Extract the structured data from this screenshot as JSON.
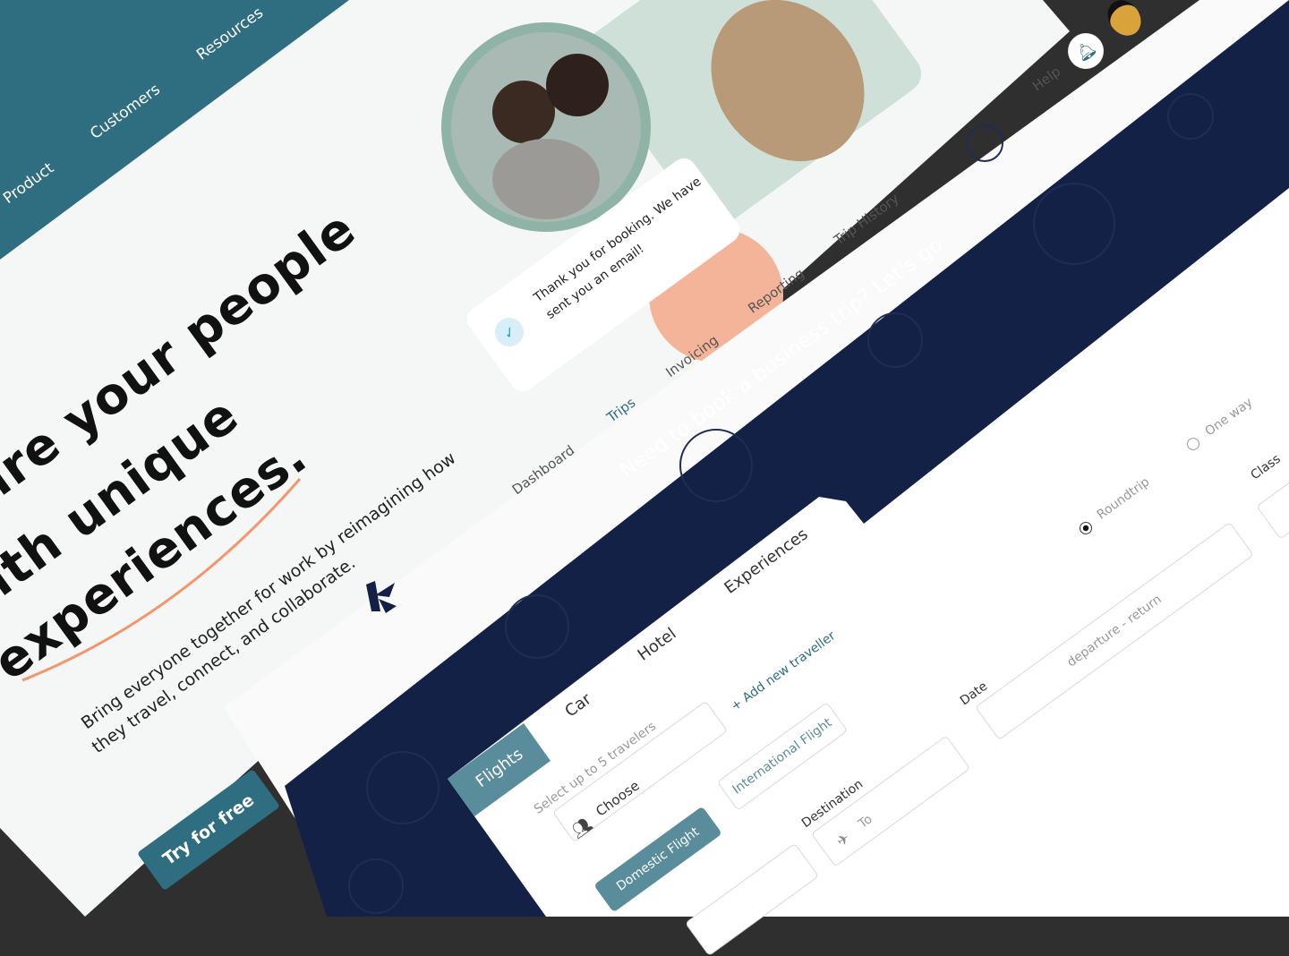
{
  "landing": {
    "nav": [
      "Product",
      "Customers",
      "Resources"
    ],
    "headline": [
      "ire your people",
      "ith unique",
      "experiences."
    ],
    "paragraph": [
      "Bring everyone together for work by reimagining how",
      "they travel, connect, and collaborate."
    ],
    "cta": "Try for free",
    "toast": [
      "Thank you for booking. We have",
      "sent you an email!"
    ]
  },
  "app": {
    "nav": [
      "Dashboard",
      "Trips",
      "Invoicing",
      "Reporting",
      "Trip History"
    ],
    "active_nav": "Trips",
    "help": "Help",
    "hero": "Need to book a business trip? Let's go",
    "tabs": [
      "Flights",
      "Car",
      "Hotel",
      "Experiences"
    ],
    "active_tab": "Flights",
    "travelers_label": "Select up to 5 travelers",
    "travelers_value": "Choose",
    "add_traveller": "+ Add new traveller",
    "flight_types": [
      "Domestic Flight",
      "International Flight"
    ],
    "destination_label": "Destination",
    "destination_placeholder": "To",
    "date_label": "Date",
    "date_placeholder": "departure - return",
    "trip_types": [
      "Roundtrip",
      "One way"
    ],
    "selected_trip_type": "Roundtrip",
    "class_label": "Class"
  },
  "colors": {
    "teal": "#2e6e80",
    "navy": "#142147",
    "peach": "#f4b49a",
    "tab_teal": "#5a8d9c"
  }
}
